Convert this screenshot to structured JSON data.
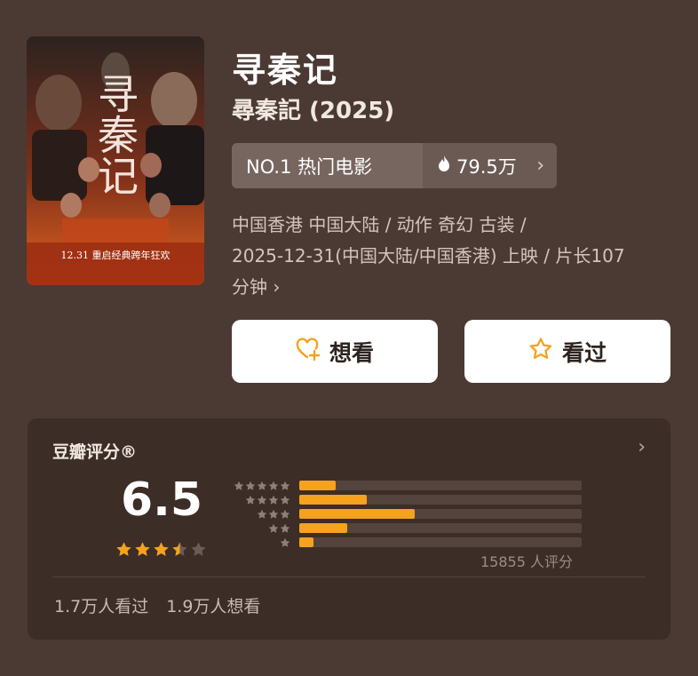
{
  "movie": {
    "title": "寻秦记",
    "subtitle": "尋秦記 (2025)",
    "poster": {
      "title_art": "寻秦记",
      "release_tag": "12.31 重启经典跨年狂欢"
    }
  },
  "ranking": {
    "label": "NO.1 热门电影",
    "heat": "79.5万",
    "icon": "flame-icon"
  },
  "meta": {
    "line1": "中国香港 中国大陆 / 动作 奇幻 古装 /",
    "line2": "2025-12-31(中国大陆/中国香港) 上映 / 片长107",
    "line3": "分钟"
  },
  "actions": {
    "want_label": "想看",
    "seen_label": "看过"
  },
  "rating": {
    "title": "豆瓣评分®",
    "score": "6.5",
    "stars": 3.5,
    "distribution": [
      0.13,
      0.24,
      0.41,
      0.17,
      0.05
    ],
    "count_text": "15855 人评分",
    "seen_text": "1.7万人看过",
    "want_text": "1.9万人想看"
  },
  "colors": {
    "background": "#4b3a33",
    "card": "#3c2d27",
    "accent": "#f5a21e"
  }
}
